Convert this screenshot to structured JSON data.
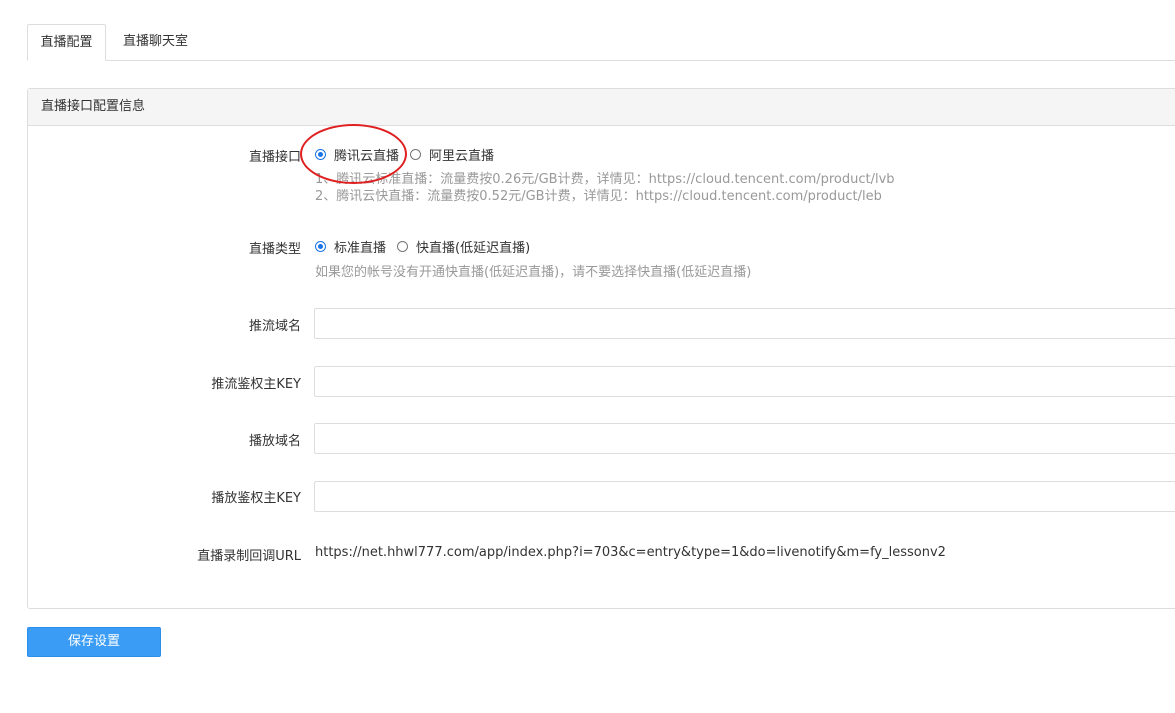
{
  "tabs": [
    {
      "label": "直播配置",
      "active": true
    },
    {
      "label": "直播聊天室",
      "active": false
    }
  ],
  "panel": {
    "title": "直播接口配置信息"
  },
  "form": {
    "interface": {
      "label": "直播接口",
      "options": [
        {
          "label": "腾讯云直播",
          "checked": true
        },
        {
          "label": "阿里云直播",
          "checked": false
        }
      ],
      "help_lines": [
        "1、腾讯云标准直播：流量费按0.26元/GB计费，详情见：https://cloud.tencent.com/product/lvb",
        "2、腾讯云快直播：流量费按0.52元/GB计费，详情见：https://cloud.tencent.com/product/leb"
      ]
    },
    "type": {
      "label": "直播类型",
      "options": [
        {
          "label": "标准直播",
          "checked": true
        },
        {
          "label": "快直播(低延迟直播)",
          "checked": false
        }
      ],
      "help": "如果您的帐号没有开通快直播(低延迟直播)，请不要选择快直播(低延迟直播)"
    },
    "push_domain": {
      "label": "推流域名",
      "value": ""
    },
    "push_key": {
      "label": "推流鉴权主KEY",
      "value": ""
    },
    "play_domain": {
      "label": "播放域名",
      "value": ""
    },
    "play_key": {
      "label": "播放鉴权主KEY",
      "value": ""
    },
    "callback": {
      "label": "直播录制回调URL",
      "value": "https://net.hhwl777.com/app/index.php?i=703&c=entry&type=1&do=livenotify&m=fy_lessonv2"
    }
  },
  "save_label": "保存设置",
  "colors": {
    "accent": "#3a9cf5",
    "radio_checked": "#1a73e8",
    "annotation": "#e02020",
    "help_text": "#999999",
    "border": "#dddddd"
  }
}
